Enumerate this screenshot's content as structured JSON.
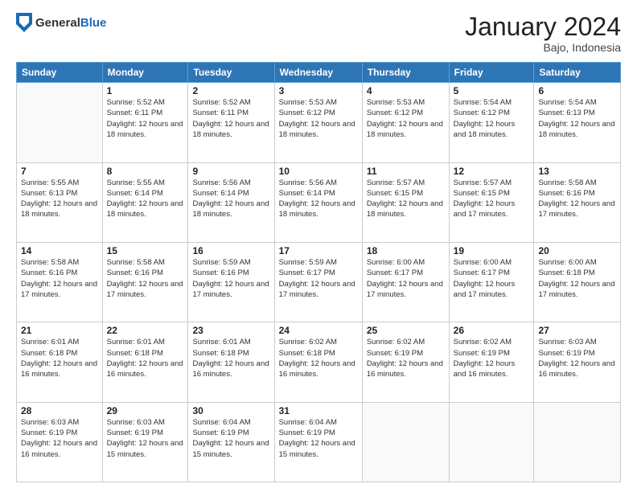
{
  "header": {
    "logo_general": "General",
    "logo_blue": "Blue",
    "month_title": "January 2024",
    "subtitle": "Bajo, Indonesia"
  },
  "days_of_week": [
    "Sunday",
    "Monday",
    "Tuesday",
    "Wednesday",
    "Thursday",
    "Friday",
    "Saturday"
  ],
  "weeks": [
    [
      {
        "day": "",
        "sunrise": "",
        "sunset": "",
        "daylight": ""
      },
      {
        "day": "1",
        "sunrise": "Sunrise: 5:52 AM",
        "sunset": "Sunset: 6:11 PM",
        "daylight": "Daylight: 12 hours and 18 minutes."
      },
      {
        "day": "2",
        "sunrise": "Sunrise: 5:52 AM",
        "sunset": "Sunset: 6:11 PM",
        "daylight": "Daylight: 12 hours and 18 minutes."
      },
      {
        "day": "3",
        "sunrise": "Sunrise: 5:53 AM",
        "sunset": "Sunset: 6:12 PM",
        "daylight": "Daylight: 12 hours and 18 minutes."
      },
      {
        "day": "4",
        "sunrise": "Sunrise: 5:53 AM",
        "sunset": "Sunset: 6:12 PM",
        "daylight": "Daylight: 12 hours and 18 minutes."
      },
      {
        "day": "5",
        "sunrise": "Sunrise: 5:54 AM",
        "sunset": "Sunset: 6:12 PM",
        "daylight": "Daylight: 12 hours and 18 minutes."
      },
      {
        "day": "6",
        "sunrise": "Sunrise: 5:54 AM",
        "sunset": "Sunset: 6:13 PM",
        "daylight": "Daylight: 12 hours and 18 minutes."
      }
    ],
    [
      {
        "day": "7",
        "sunrise": "Sunrise: 5:55 AM",
        "sunset": "Sunset: 6:13 PM",
        "daylight": "Daylight: 12 hours and 18 minutes."
      },
      {
        "day": "8",
        "sunrise": "Sunrise: 5:55 AM",
        "sunset": "Sunset: 6:14 PM",
        "daylight": "Daylight: 12 hours and 18 minutes."
      },
      {
        "day": "9",
        "sunrise": "Sunrise: 5:56 AM",
        "sunset": "Sunset: 6:14 PM",
        "daylight": "Daylight: 12 hours and 18 minutes."
      },
      {
        "day": "10",
        "sunrise": "Sunrise: 5:56 AM",
        "sunset": "Sunset: 6:14 PM",
        "daylight": "Daylight: 12 hours and 18 minutes."
      },
      {
        "day": "11",
        "sunrise": "Sunrise: 5:57 AM",
        "sunset": "Sunset: 6:15 PM",
        "daylight": "Daylight: 12 hours and 18 minutes."
      },
      {
        "day": "12",
        "sunrise": "Sunrise: 5:57 AM",
        "sunset": "Sunset: 6:15 PM",
        "daylight": "Daylight: 12 hours and 17 minutes."
      },
      {
        "day": "13",
        "sunrise": "Sunrise: 5:58 AM",
        "sunset": "Sunset: 6:16 PM",
        "daylight": "Daylight: 12 hours and 17 minutes."
      }
    ],
    [
      {
        "day": "14",
        "sunrise": "Sunrise: 5:58 AM",
        "sunset": "Sunset: 6:16 PM",
        "daylight": "Daylight: 12 hours and 17 minutes."
      },
      {
        "day": "15",
        "sunrise": "Sunrise: 5:58 AM",
        "sunset": "Sunset: 6:16 PM",
        "daylight": "Daylight: 12 hours and 17 minutes."
      },
      {
        "day": "16",
        "sunrise": "Sunrise: 5:59 AM",
        "sunset": "Sunset: 6:16 PM",
        "daylight": "Daylight: 12 hours and 17 minutes."
      },
      {
        "day": "17",
        "sunrise": "Sunrise: 5:59 AM",
        "sunset": "Sunset: 6:17 PM",
        "daylight": "Daylight: 12 hours and 17 minutes."
      },
      {
        "day": "18",
        "sunrise": "Sunrise: 6:00 AM",
        "sunset": "Sunset: 6:17 PM",
        "daylight": "Daylight: 12 hours and 17 minutes."
      },
      {
        "day": "19",
        "sunrise": "Sunrise: 6:00 AM",
        "sunset": "Sunset: 6:17 PM",
        "daylight": "Daylight: 12 hours and 17 minutes."
      },
      {
        "day": "20",
        "sunrise": "Sunrise: 6:00 AM",
        "sunset": "Sunset: 6:18 PM",
        "daylight": "Daylight: 12 hours and 17 minutes."
      }
    ],
    [
      {
        "day": "21",
        "sunrise": "Sunrise: 6:01 AM",
        "sunset": "Sunset: 6:18 PM",
        "daylight": "Daylight: 12 hours and 16 minutes."
      },
      {
        "day": "22",
        "sunrise": "Sunrise: 6:01 AM",
        "sunset": "Sunset: 6:18 PM",
        "daylight": "Daylight: 12 hours and 16 minutes."
      },
      {
        "day": "23",
        "sunrise": "Sunrise: 6:01 AM",
        "sunset": "Sunset: 6:18 PM",
        "daylight": "Daylight: 12 hours and 16 minutes."
      },
      {
        "day": "24",
        "sunrise": "Sunrise: 6:02 AM",
        "sunset": "Sunset: 6:18 PM",
        "daylight": "Daylight: 12 hours and 16 minutes."
      },
      {
        "day": "25",
        "sunrise": "Sunrise: 6:02 AM",
        "sunset": "Sunset: 6:19 PM",
        "daylight": "Daylight: 12 hours and 16 minutes."
      },
      {
        "day": "26",
        "sunrise": "Sunrise: 6:02 AM",
        "sunset": "Sunset: 6:19 PM",
        "daylight": "Daylight: 12 hours and 16 minutes."
      },
      {
        "day": "27",
        "sunrise": "Sunrise: 6:03 AM",
        "sunset": "Sunset: 6:19 PM",
        "daylight": "Daylight: 12 hours and 16 minutes."
      }
    ],
    [
      {
        "day": "28",
        "sunrise": "Sunrise: 6:03 AM",
        "sunset": "Sunset: 6:19 PM",
        "daylight": "Daylight: 12 hours and 16 minutes."
      },
      {
        "day": "29",
        "sunrise": "Sunrise: 6:03 AM",
        "sunset": "Sunset: 6:19 PM",
        "daylight": "Daylight: 12 hours and 15 minutes."
      },
      {
        "day": "30",
        "sunrise": "Sunrise: 6:04 AM",
        "sunset": "Sunset: 6:19 PM",
        "daylight": "Daylight: 12 hours and 15 minutes."
      },
      {
        "day": "31",
        "sunrise": "Sunrise: 6:04 AM",
        "sunset": "Sunset: 6:19 PM",
        "daylight": "Daylight: 12 hours and 15 minutes."
      },
      {
        "day": "",
        "sunrise": "",
        "sunset": "",
        "daylight": ""
      },
      {
        "day": "",
        "sunrise": "",
        "sunset": "",
        "daylight": ""
      },
      {
        "day": "",
        "sunrise": "",
        "sunset": "",
        "daylight": ""
      }
    ]
  ]
}
